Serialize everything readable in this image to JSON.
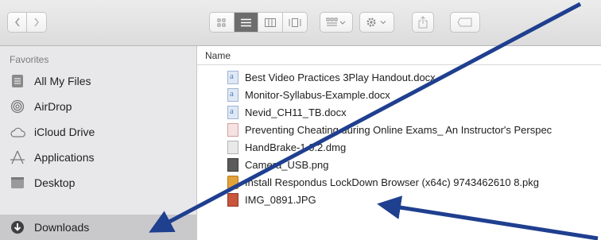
{
  "toolbar": {
    "back_icon": "chevron-left-icon",
    "forward_icon": "chevron-right-icon",
    "view_modes": [
      "icon-view-icon",
      "list-view-icon",
      "column-view-icon",
      "gallery-view-icon"
    ],
    "active_view": "list-view-icon",
    "group_icon": "group-by-icon",
    "action_icon": "gear-icon",
    "share_icon": "share-icon",
    "tag_icon": "tag-icon"
  },
  "sidebar": {
    "header": "Favorites",
    "items": [
      {
        "label": "All My Files",
        "icon": "all-files-icon"
      },
      {
        "label": "AirDrop",
        "icon": "airdrop-icon"
      },
      {
        "label": "iCloud Drive",
        "icon": "cloud-icon"
      },
      {
        "label": "Applications",
        "icon": "applications-icon"
      },
      {
        "label": "Desktop",
        "icon": "desktop-icon"
      },
      {
        "label": "Downloads",
        "icon": "downloads-icon",
        "selected": true
      }
    ]
  },
  "list": {
    "column_name": "Name",
    "files": [
      {
        "name": "Best Video Practices  3Play Handout.docx",
        "icon": "docx-icon"
      },
      {
        "name": "Monitor-Syllabus-Example.docx",
        "icon": "docx-icon"
      },
      {
        "name": "Nevid_CH11_TB.docx",
        "icon": "docx-icon"
      },
      {
        "name": "Preventing Cheating during Online Exams_ An Instructor's Perspec",
        "icon": "pdf-icon"
      },
      {
        "name": "HandBrake-1.0.2.dmg",
        "icon": "dmg-icon"
      },
      {
        "name": "Camera_USB.png",
        "icon": "png-icon"
      },
      {
        "name": "Install Respondus LockDown Browser (x64c) 9743462610 8.pkg",
        "icon": "pkg-icon"
      },
      {
        "name": "IMG_0891.JPG",
        "icon": "jpg-icon"
      }
    ]
  },
  "colors": {
    "arrow": "#1f3f8f",
    "selected_row": "#c9c9cc",
    "sidebar_bg": "#e8e8ea"
  }
}
